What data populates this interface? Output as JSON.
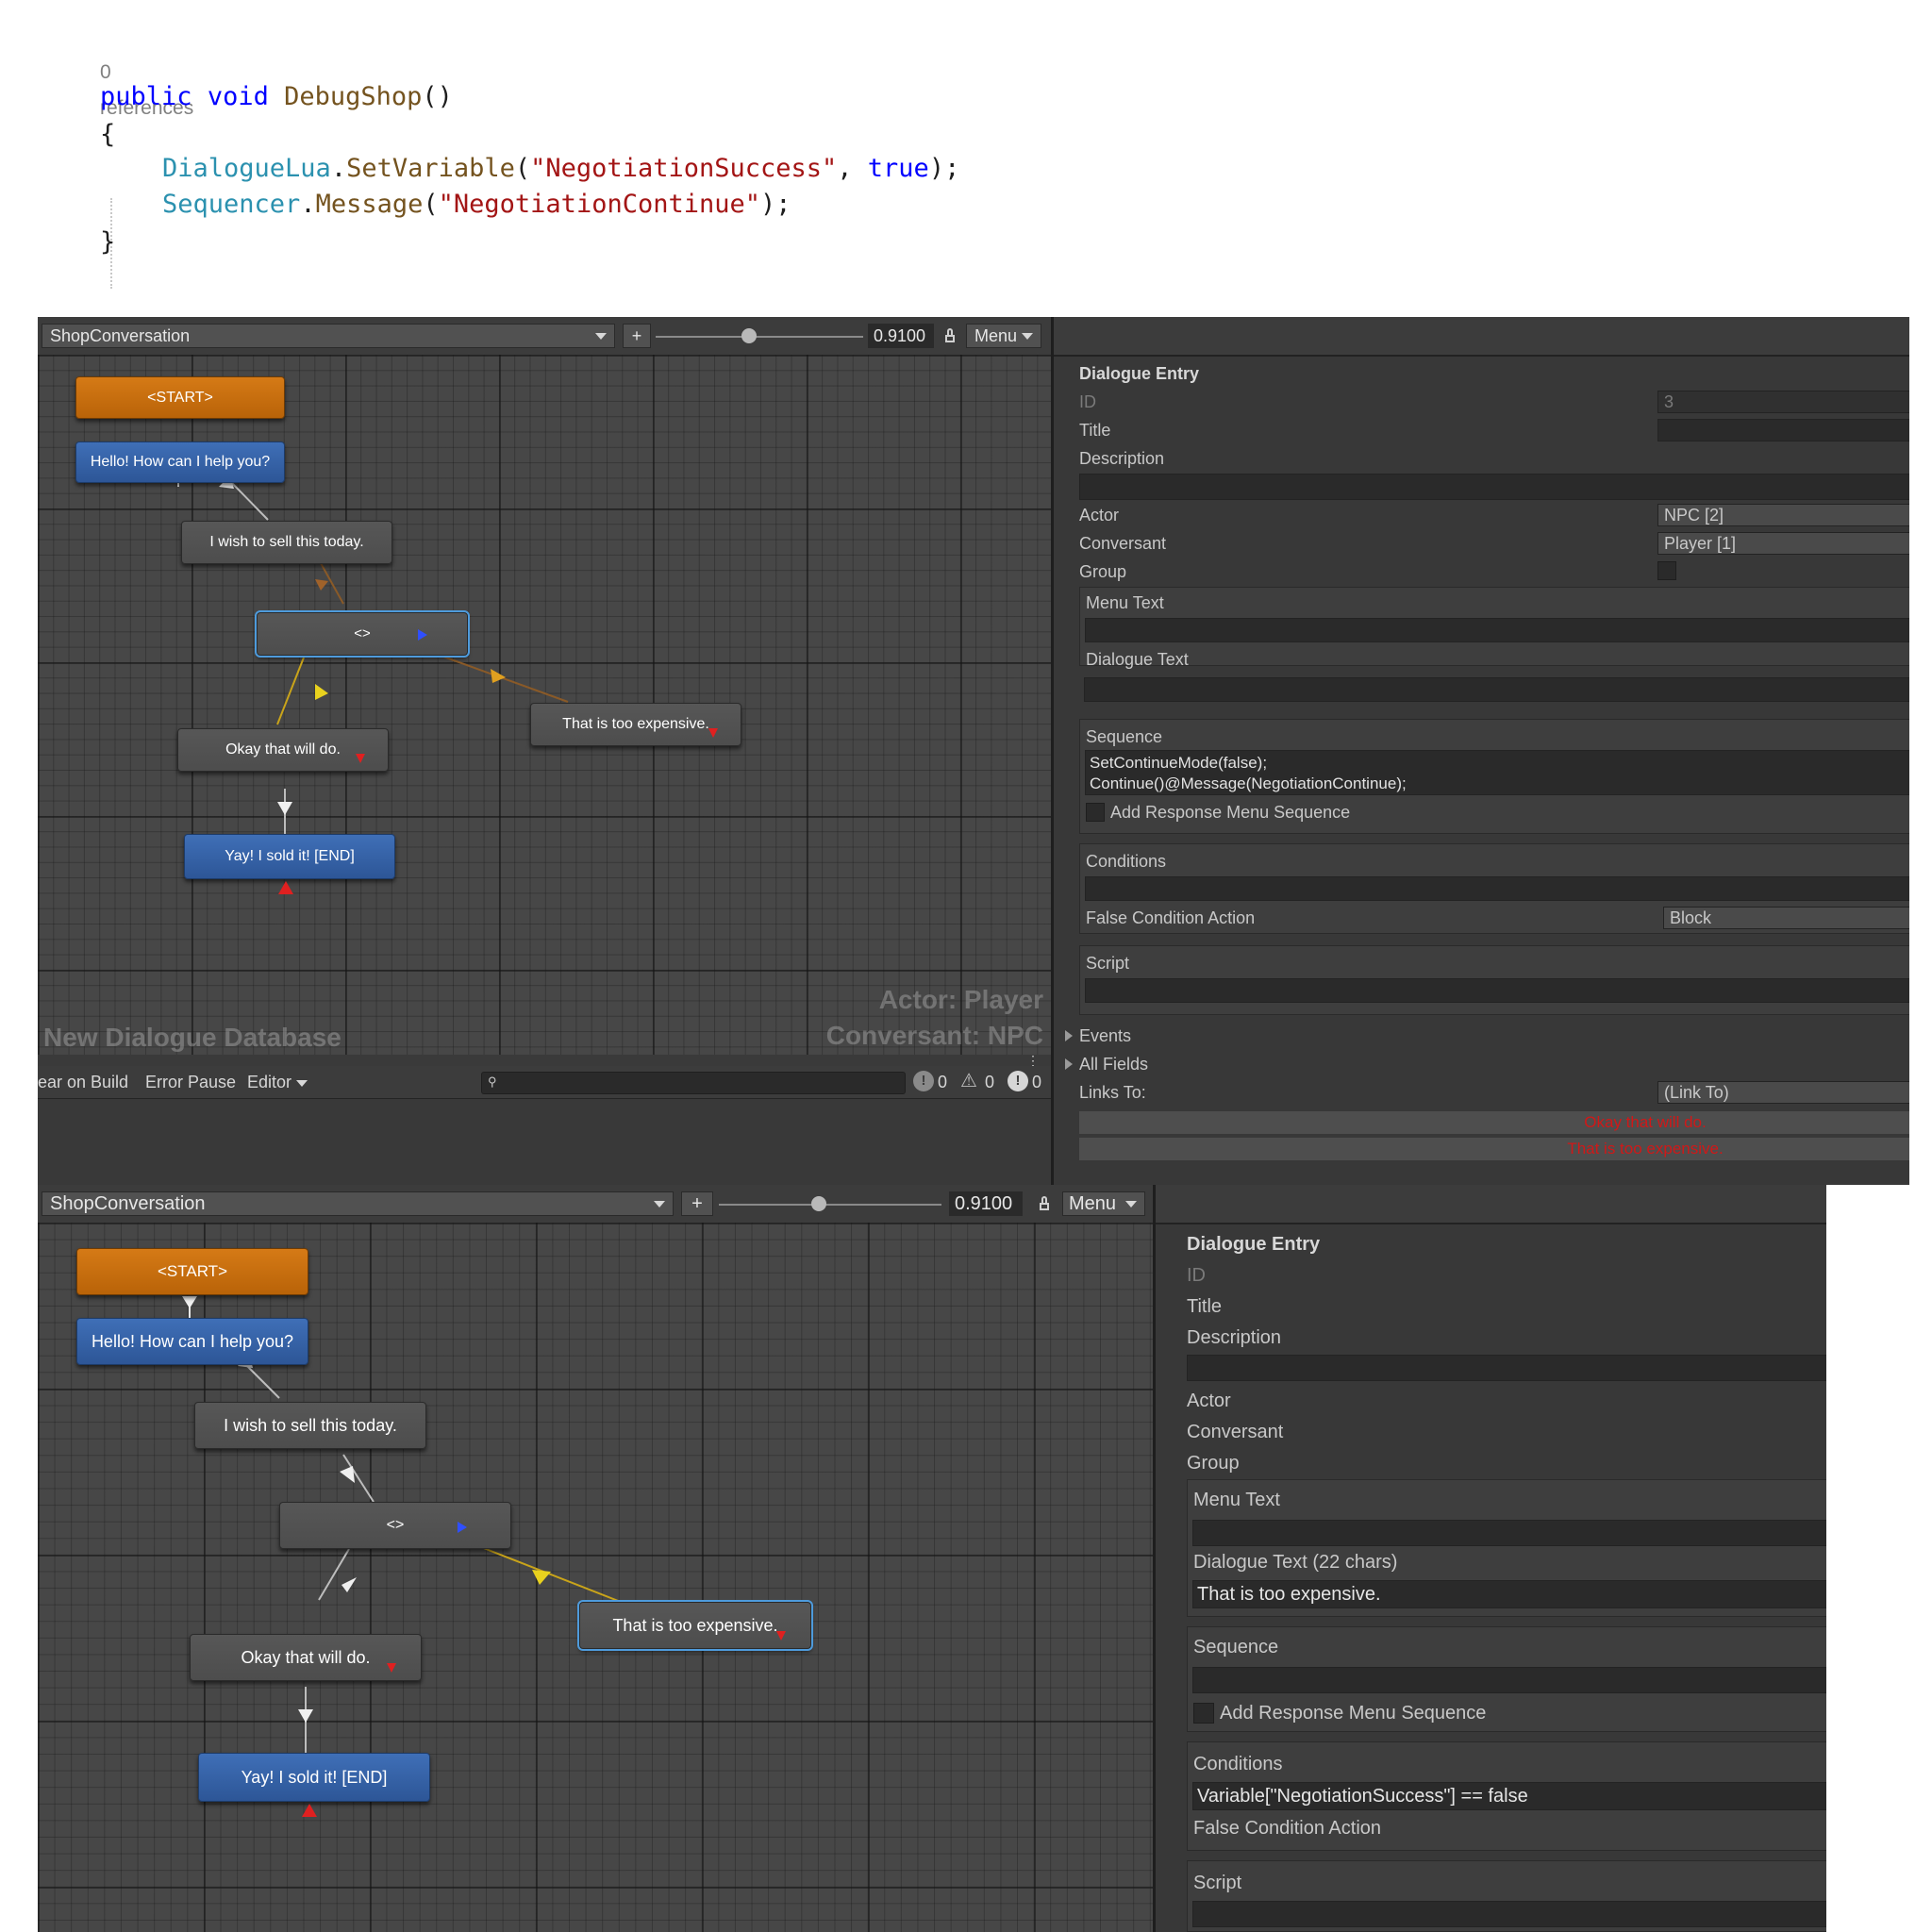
{
  "code": {
    "references": "0 references",
    "line1": [
      "public",
      " ",
      "void",
      " ",
      "DebugShop",
      "()"
    ],
    "brace_open": "{",
    "line2": [
      "DialogueLua",
      ".",
      "SetVariable",
      "(",
      "\"NegotiationSuccess\"",
      ", ",
      "true",
      ");"
    ],
    "line3": [
      "Sequencer",
      ".",
      "Message",
      "(",
      "\"NegotiationContinue\"",
      ");"
    ],
    "brace_close": "}"
  },
  "top": {
    "conversation": "ShopConversation",
    "plus": "+",
    "zoom": "0.9100",
    "zoom_fraction": 0.45,
    "menu": "Menu",
    "nodes": {
      "start": "<START>",
      "hello": "Hello! How can I help you?",
      "sell": "I wish to sell this today.",
      "group": "<>",
      "expensive": "That is too expensive.",
      "okay": "Okay that will do.",
      "end": "Yay! I sold it! [END]"
    },
    "watermark_db": "New Dialogue Database",
    "watermark_actor": "Actor: Player",
    "watermark_conversant": "Conversant: NPC",
    "console": {
      "clear_on_build": "ear on Build",
      "error_pause": "Error Pause",
      "editor": "Editor",
      "log_count": "0",
      "warn_count": "0",
      "error_count": "0"
    },
    "inspector": {
      "header": "Dialogue Entry",
      "id_label": "ID",
      "id_value": "3",
      "title_label": "Title",
      "description_label": "Description",
      "actor_label": "Actor",
      "actor_value": "NPC [2]",
      "conversant_label": "Conversant",
      "conversant_value": "Player [1]",
      "group_label": "Group",
      "menu_text_label": "Menu Text",
      "dialogue_text_label": "Dialogue Text",
      "sequence_label": "Sequence",
      "sequence_line1": "SetContinueMode(false);",
      "sequence_line2": "Continue()@Message(NegotiationContinue);",
      "add_response_label": "Add Response Menu Sequence",
      "conditions_label": "Conditions",
      "false_condition_label": "False Condition Action",
      "false_condition_value": "Block",
      "script_label": "Script",
      "events_label": "Events",
      "all_fields_label": "All Fields",
      "links_to_label": "Links To:",
      "links_to_value": "(Link To)",
      "link1": "Okay that will do.",
      "link2": "That is too expensive."
    }
  },
  "bottom": {
    "conversation": "ShopConversation",
    "plus": "+",
    "zoom": "0.9100",
    "zoom_fraction": 0.45,
    "menu": "Menu",
    "nodes": {
      "start": "<START>",
      "hello": "Hello! How can I help you?",
      "sell": "I wish to sell this today.",
      "group": "<>",
      "expensive": "That is too expensive.",
      "okay": "Okay that will do.",
      "end": "Yay! I sold it! [END]"
    },
    "inspector": {
      "header": "Dialogue Entry",
      "id_label": "ID",
      "title_label": "Title",
      "description_label": "Description",
      "actor_label": "Actor",
      "conversant_label": "Conversant",
      "group_label": "Group",
      "menu_text_label": "Menu Text",
      "dialogue_text_label": "Dialogue Text (22 chars)",
      "dialogue_text_value": "That is too expensive.",
      "sequence_label": "Sequence",
      "add_response_label": "Add Response Menu Sequence",
      "conditions_label": "Conditions",
      "conditions_value": "Variable[\"NegotiationSuccess\"] == false",
      "false_condition_label": "False Condition Action",
      "script_label": "Script"
    }
  },
  "colors": {
    "start_node": "#c86d10",
    "npc_node": "#3563a8",
    "player_node": "#525252",
    "selected_outline": "#4e9bdc",
    "link_error_text": "#d01818"
  }
}
